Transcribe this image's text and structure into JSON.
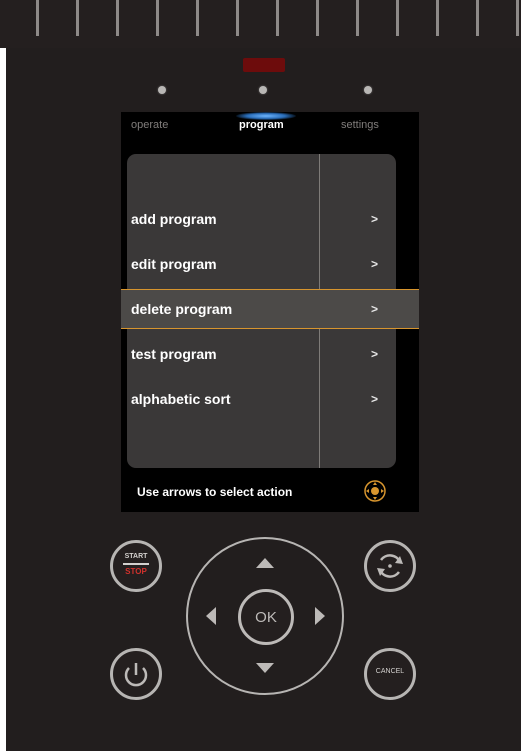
{
  "tabs": {
    "operate": "operate",
    "program": "program",
    "settings": "settings"
  },
  "menu": {
    "items": [
      {
        "label": "add program",
        "arrow": ">"
      },
      {
        "label": "edit program",
        "arrow": ">"
      },
      {
        "label": "delete program",
        "arrow": ">"
      },
      {
        "label": "test program",
        "arrow": ">"
      },
      {
        "label": "alphabetic sort",
        "arrow": ">"
      }
    ],
    "selected_index": 2
  },
  "hint": "Use arrows to select action",
  "controls": {
    "start_label": "START",
    "stop_label": "STOP",
    "ok_label": "OK",
    "cancel_label": "CANCEL"
  },
  "colors": {
    "panel": "#221e1e",
    "selection_accent": "#d7952e",
    "stop_red": "#d1312c",
    "active_tab_glow": "#6fb6ff",
    "indicator_red": "#6d0c0c"
  },
  "icons": {
    "nav_hint": "dpad-ok-icon",
    "refresh": "refresh-icon",
    "power": "power-icon"
  }
}
